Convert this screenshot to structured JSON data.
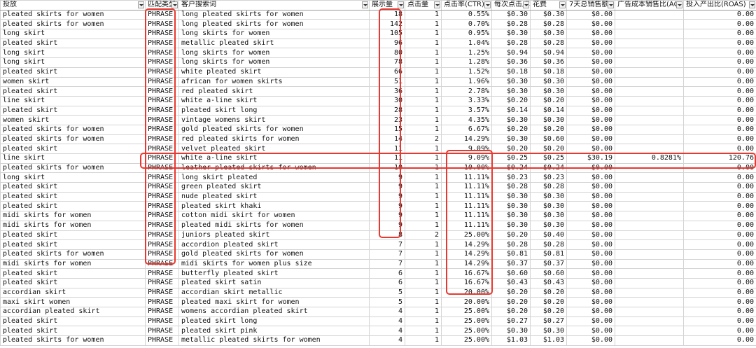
{
  "columns": [
    "投放",
    "匹配类型",
    "客户搜索词",
    "展示量",
    "点击量",
    "点击率(CTR)",
    "每次点击成本",
    "花费",
    "7天总销售额",
    "广告成本销售比(ACoS)",
    "投入产出比(ROAS)"
  ],
  "rows": [
    [
      "pleated skirts for women",
      "PHRASE",
      "long pleated skirts for women",
      "18",
      "1",
      "0.55%",
      "$0.30",
      "$0.30",
      "$0.00",
      "",
      "0.00"
    ],
    [
      "pleated skirts for women",
      "PHRASE",
      "long pleated skirts for women",
      "142",
      "1",
      "0.70%",
      "$0.28",
      "$0.28",
      "$0.00",
      "",
      "0.00"
    ],
    [
      "long skirt",
      "PHRASE",
      "long skirts for women",
      "105",
      "1",
      "0.95%",
      "$0.30",
      "$0.30",
      "$0.00",
      "",
      "0.00"
    ],
    [
      "pleated skirt",
      "PHRASE",
      "metallic pleated skirt",
      "96",
      "1",
      "1.04%",
      "$0.28",
      "$0.28",
      "$0.00",
      "",
      "0.00"
    ],
    [
      "long skirt",
      "PHRASE",
      "long skirts for women",
      "80",
      "1",
      "1.25%",
      "$0.94",
      "$0.94",
      "$0.00",
      "",
      "0.00"
    ],
    [
      "long skirt",
      "PHRASE",
      "long skirts for women",
      "78",
      "1",
      "1.28%",
      "$0.36",
      "$0.36",
      "$0.00",
      "",
      "0.00"
    ],
    [
      "pleated skirt",
      "PHRASE",
      "white pleated skirt",
      "66",
      "1",
      "1.52%",
      "$0.18",
      "$0.18",
      "$0.00",
      "",
      "0.00"
    ],
    [
      "women skirt",
      "PHRASE",
      "african for women skirts",
      "51",
      "1",
      "1.96%",
      "$0.30",
      "$0.30",
      "$0.00",
      "",
      "0.00"
    ],
    [
      "pleated skirt",
      "PHRASE",
      "red pleated skirt",
      "36",
      "1",
      "2.78%",
      "$0.30",
      "$0.30",
      "$0.00",
      "",
      "0.00"
    ],
    [
      "line skirt",
      "PHRASE",
      "white a-line skirt",
      "30",
      "1",
      "3.33%",
      "$0.20",
      "$0.20",
      "$0.00",
      "",
      "0.00"
    ],
    [
      "pleated skirt",
      "PHRASE",
      "pleated skirt long",
      "28",
      "1",
      "3.57%",
      "$0.14",
      "$0.14",
      "$0.00",
      "",
      "0.00"
    ],
    [
      "women skirt",
      "PHRASE",
      "vintage womens skirt",
      "23",
      "1",
      "4.35%",
      "$0.30",
      "$0.30",
      "$0.00",
      "",
      "0.00"
    ],
    [
      "pleated skirts for women",
      "PHRASE",
      "gold pleated skirts for women",
      "15",
      "1",
      "6.67%",
      "$0.20",
      "$0.20",
      "$0.00",
      "",
      "0.00"
    ],
    [
      "pleated skirts for women",
      "PHRASE",
      "red pleated skirts for women",
      "14",
      "2",
      "14.29%",
      "$0.30",
      "$0.60",
      "$0.00",
      "",
      "0.00"
    ],
    [
      "pleated skirt",
      "PHRASE",
      "velvet pleated skirt",
      "11",
      "1",
      "9.09%",
      "$0.20",
      "$0.20",
      "$0.00",
      "",
      "0.00"
    ],
    [
      "line skirt",
      "PHRASE",
      "white a-line skirt",
      "11",
      "1",
      "9.09%",
      "$0.25",
      "$0.25",
      "$30.19",
      "0.8281%",
      "120.76"
    ],
    [
      "pleated skirts for women",
      "PHRASE",
      "leather pleated skirts for women",
      "10",
      "1",
      "10.00%",
      "$0.24",
      "$0.24",
      "$0.00",
      "",
      "0.00"
    ],
    [
      "long skirt",
      "PHRASE",
      "long skirt pleated",
      "9",
      "1",
      "11.11%",
      "$0.23",
      "$0.23",
      "$0.00",
      "",
      "0.00"
    ],
    [
      "pleated skirt",
      "PHRASE",
      "green pleated skirt",
      "9",
      "1",
      "11.11%",
      "$0.28",
      "$0.28",
      "$0.00",
      "",
      "0.00"
    ],
    [
      "pleated skirt",
      "PHRASE",
      "nude pleated skirt",
      "9",
      "1",
      "11.11%",
      "$0.30",
      "$0.30",
      "$0.00",
      "",
      "0.00"
    ],
    [
      "pleated skirt",
      "PHRASE",
      "pleated skirt khaki",
      "9",
      "1",
      "11.11%",
      "$0.30",
      "$0.30",
      "$0.00",
      "",
      "0.00"
    ],
    [
      "midi skirts for women",
      "PHRASE",
      "cotton midi skirt for women",
      "9",
      "1",
      "11.11%",
      "$0.30",
      "$0.30",
      "$0.00",
      "",
      "0.00"
    ],
    [
      "midi skirts for women",
      "PHRASE",
      "pleated midi skirts for women",
      "9",
      "1",
      "11.11%",
      "$0.30",
      "$0.30",
      "$0.00",
      "",
      "0.00"
    ],
    [
      "pleated skirt",
      "PHRASE",
      "juniors pleated skirt",
      "8",
      "2",
      "25.00%",
      "$0.20",
      "$0.40",
      "$0.00",
      "",
      "0.00"
    ],
    [
      "pleated skirt",
      "PHRASE",
      "accordion pleated skirt",
      "7",
      "1",
      "14.29%",
      "$0.28",
      "$0.28",
      "$0.00",
      "",
      "0.00"
    ],
    [
      "pleated skirts for women",
      "PHRASE",
      "gold pleated skirts for women",
      "7",
      "1",
      "14.29%",
      "$0.81",
      "$0.81",
      "$0.00",
      "",
      "0.00"
    ],
    [
      "midi skirts for women",
      "PHRASE",
      "midi skirts for women plus size",
      "7",
      "1",
      "14.29%",
      "$0.37",
      "$0.37",
      "$0.00",
      "",
      "0.00"
    ],
    [
      "pleated skirt",
      "PHRASE",
      "butterfly pleated skirt",
      "6",
      "1",
      "16.67%",
      "$0.60",
      "$0.60",
      "$0.00",
      "",
      "0.00"
    ],
    [
      "pleated skirt",
      "PHRASE",
      "pleated skirt satin",
      "6",
      "1",
      "16.67%",
      "$0.43",
      "$0.43",
      "$0.00",
      "",
      "0.00"
    ],
    [
      "accordian skirt",
      "PHRASE",
      "accordian skirt metallic",
      "5",
      "1",
      "20.00%",
      "$0.20",
      "$0.20",
      "$0.00",
      "",
      "0.00"
    ],
    [
      "maxi skirt women",
      "PHRASE",
      "pleated maxi skirt for women",
      "5",
      "1",
      "20.00%",
      "$0.20",
      "$0.20",
      "$0.00",
      "",
      "0.00"
    ],
    [
      "accordian pleated skirt",
      "PHRASE",
      "womens accordian pleated skirt",
      "4",
      "1",
      "25.00%",
      "$0.20",
      "$0.20",
      "$0.00",
      "",
      "0.00"
    ],
    [
      "pleated skirt",
      "PHRASE",
      "pleated skirt long",
      "4",
      "1",
      "25.00%",
      "$0.27",
      "$0.27",
      "$0.00",
      "",
      "0.00"
    ],
    [
      "pleated skirt",
      "PHRASE",
      "pleated skirt pink",
      "4",
      "1",
      "25.00%",
      "$0.30",
      "$0.30",
      "$0.00",
      "",
      "0.00"
    ],
    [
      "pleated skirts for women",
      "PHRASE",
      "metallic pleated skirts for women",
      "4",
      "1",
      "25.00%",
      "$1.03",
      "$1.03",
      "$0.00",
      "",
      "0.00"
    ]
  ],
  "colors": {
    "highlight": "#e8382f",
    "grid": "#d4d4d4"
  },
  "icons": [
    "filter-dropdown-icon"
  ]
}
